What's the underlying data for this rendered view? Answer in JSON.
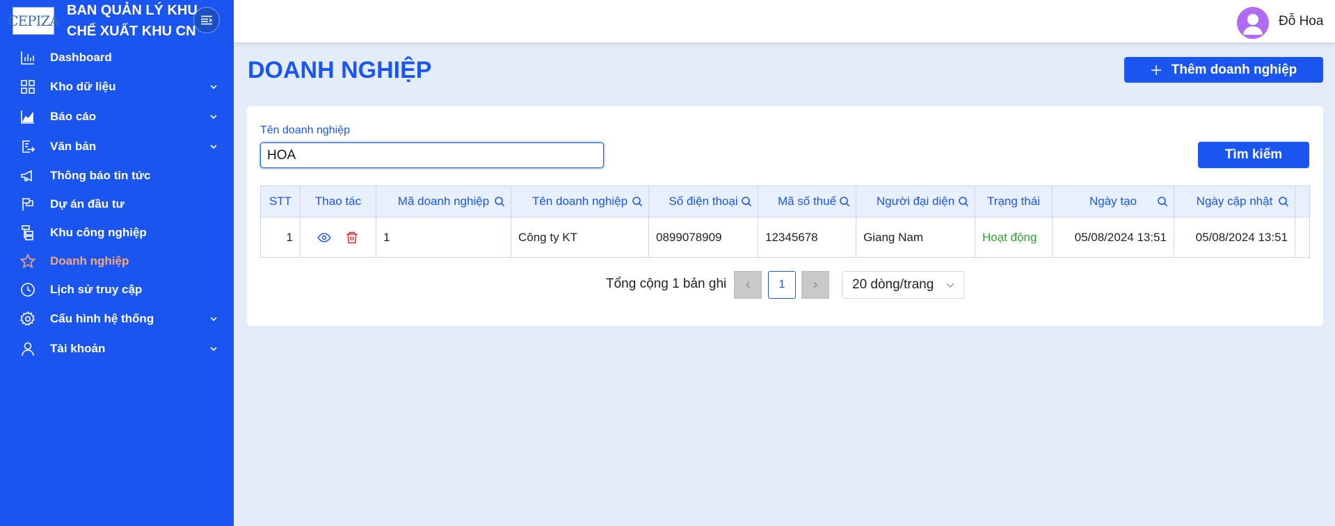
{
  "brand": {
    "logo_text": "CEPIZA",
    "title_line1": "BAN QUẢN LÝ KHU",
    "title_line2": "CHẾ XUẤT KHU CN"
  },
  "sidebar": {
    "items": [
      {
        "label": "Dashboard",
        "icon": "chart-bar-icon",
        "has_submenu": false
      },
      {
        "label": "Kho dữ liệu",
        "icon": "grid-icon",
        "has_submenu": true
      },
      {
        "label": "Báo cáo",
        "icon": "area-chart-icon",
        "has_submenu": true
      },
      {
        "label": "Văn bản",
        "icon": "document-export-icon",
        "has_submenu": true
      },
      {
        "label": "Thông báo tin tức",
        "icon": "megaphone-icon",
        "has_submenu": false
      },
      {
        "label": "Dự án đầu tư",
        "icon": "flag-icon",
        "has_submenu": false
      },
      {
        "label": "Khu công nghiệp",
        "icon": "org-chart-icon",
        "has_submenu": false
      },
      {
        "label": "Doanh nghiệp",
        "icon": "star-icon",
        "has_submenu": false,
        "active": true
      },
      {
        "label": "Lịch sử truy cập",
        "icon": "clock-icon",
        "has_submenu": false
      },
      {
        "label": "Cấu hình hệ thống",
        "icon": "gear-icon",
        "has_submenu": true
      },
      {
        "label": "Tài khoản",
        "icon": "user-icon",
        "has_submenu": true
      }
    ]
  },
  "header": {
    "user_name": "Đỗ Hoa"
  },
  "page": {
    "title": "DOANH NGHIỆP",
    "add_button_label": "Thêm doanh nghiệp"
  },
  "filter": {
    "label": "Tên doanh nghiệp",
    "value": "HOA",
    "search_button_label": "Tìm kiếm"
  },
  "table": {
    "columns": [
      "STT",
      "Thao tác",
      "Mã doanh nghiệp",
      "Tên doanh nghiệp",
      "Số điện thoại",
      "Mã số thuế",
      "Người đại diện",
      "Trạng thái",
      "Ngày tạo",
      "Ngày cập nhật"
    ],
    "rows": [
      {
        "stt": "1",
        "ma_doanh_nghiep": "1",
        "ten_doanh_nghiep": "Công ty KT",
        "so_dien_thoai": "0899078909",
        "ma_so_thue": "12345678",
        "nguoi_dai_dien": "Giang Nam",
        "trang_thai": "Hoạt động",
        "ngay_tao": "05/08/2024 13:51",
        "ngay_cap_nhat": "05/08/2024 13:51"
      }
    ]
  },
  "pagination": {
    "total_text": "Tổng cộng 1 bản ghi",
    "current_page": "1",
    "page_size": "20 dòng/trang"
  },
  "colors": {
    "primary": "#1a55f0",
    "active_menu": "#f7a97a",
    "status_active": "#2ea52e",
    "delete": "#e02424",
    "avatar": "#b06bf3"
  }
}
